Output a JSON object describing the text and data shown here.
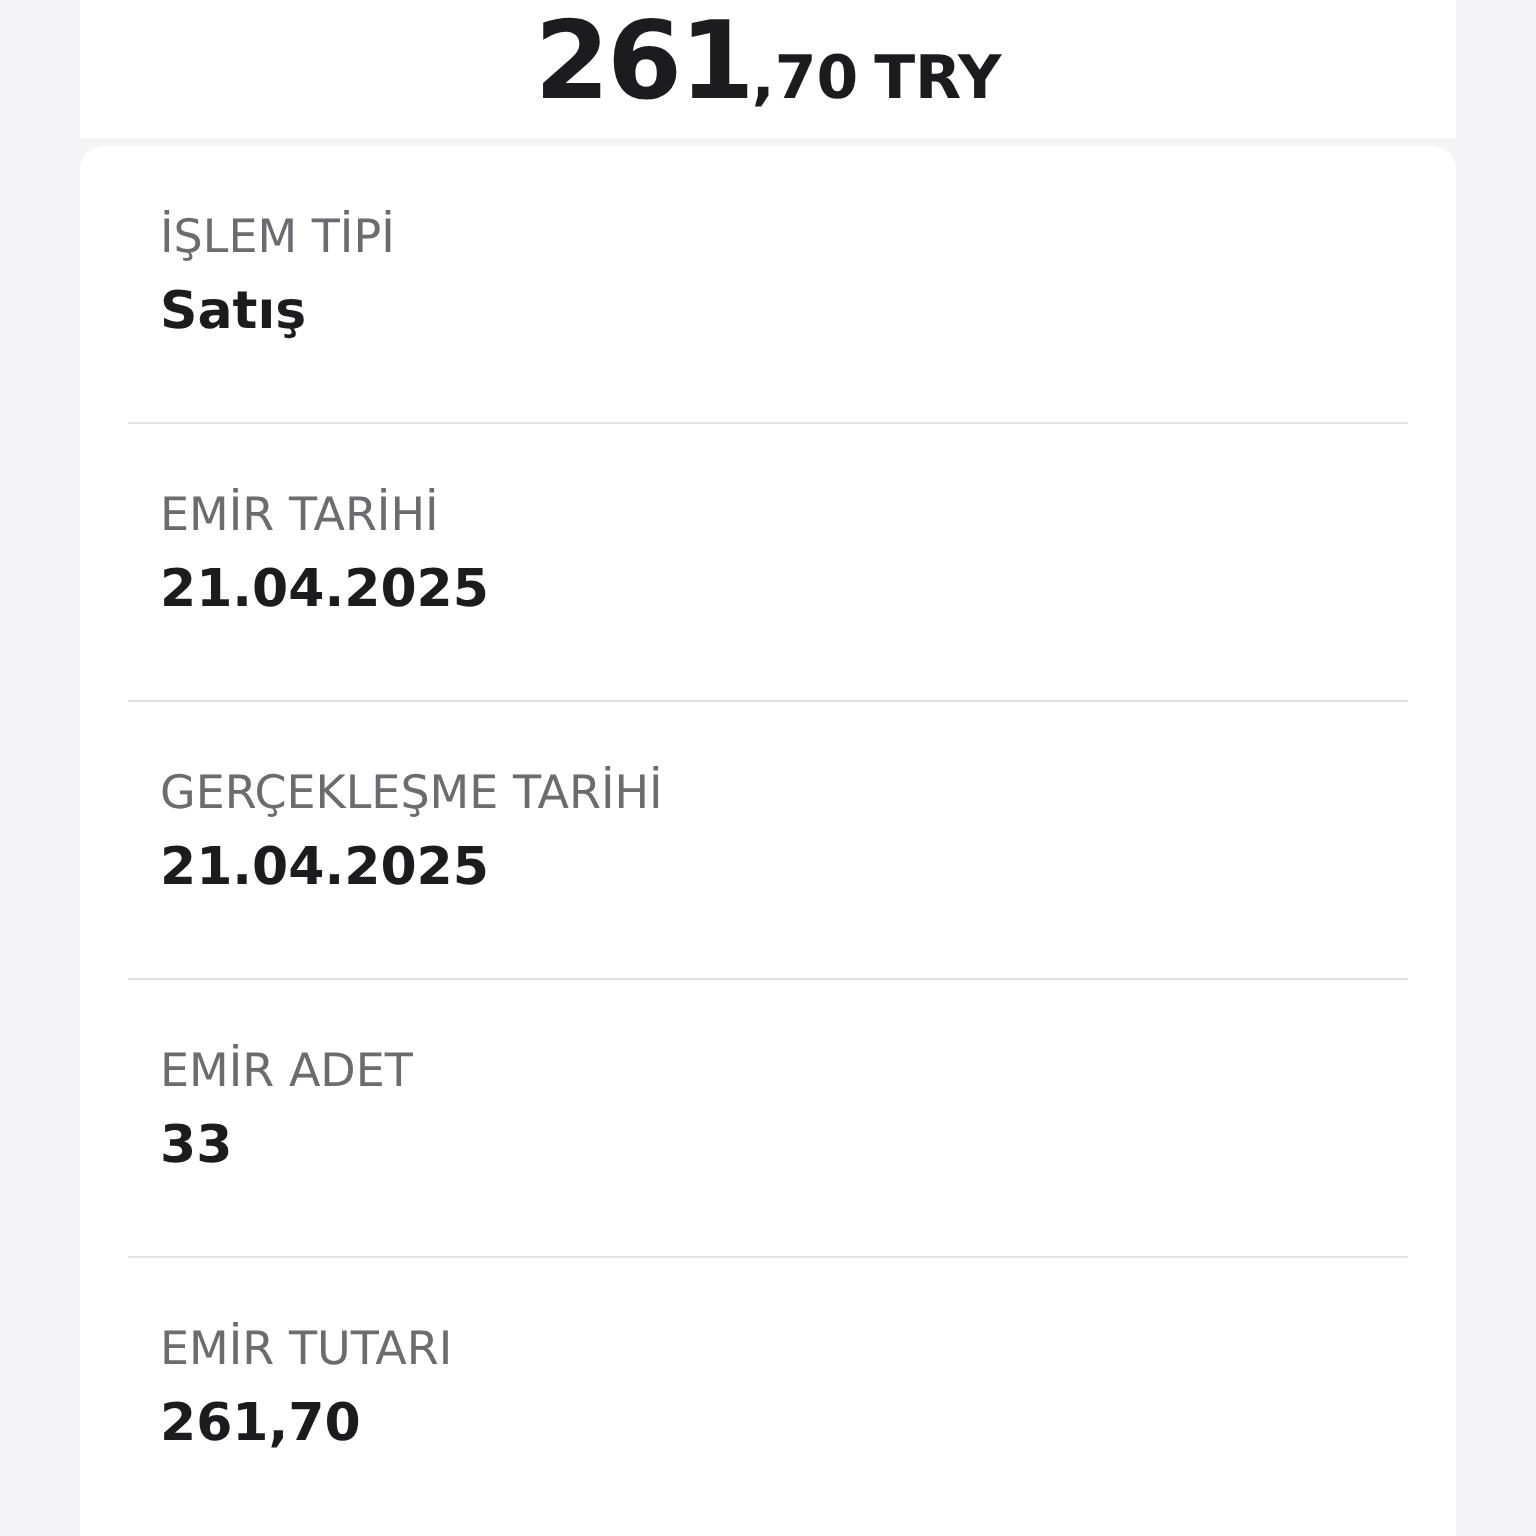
{
  "amount": {
    "integer": "261",
    "fraction": ",70",
    "currency": "TRY"
  },
  "details": [
    {
      "label": "İŞLEM TİPİ",
      "value": "Satış"
    },
    {
      "label": "EMİR TARİHİ",
      "value": "21.04.2025"
    },
    {
      "label": "GERÇEKLEŞME TARİHİ",
      "value": "21.04.2025"
    },
    {
      "label": "EMİR ADET",
      "value": "33"
    },
    {
      "label": "EMİR TUTARI",
      "value": "261,70"
    }
  ]
}
